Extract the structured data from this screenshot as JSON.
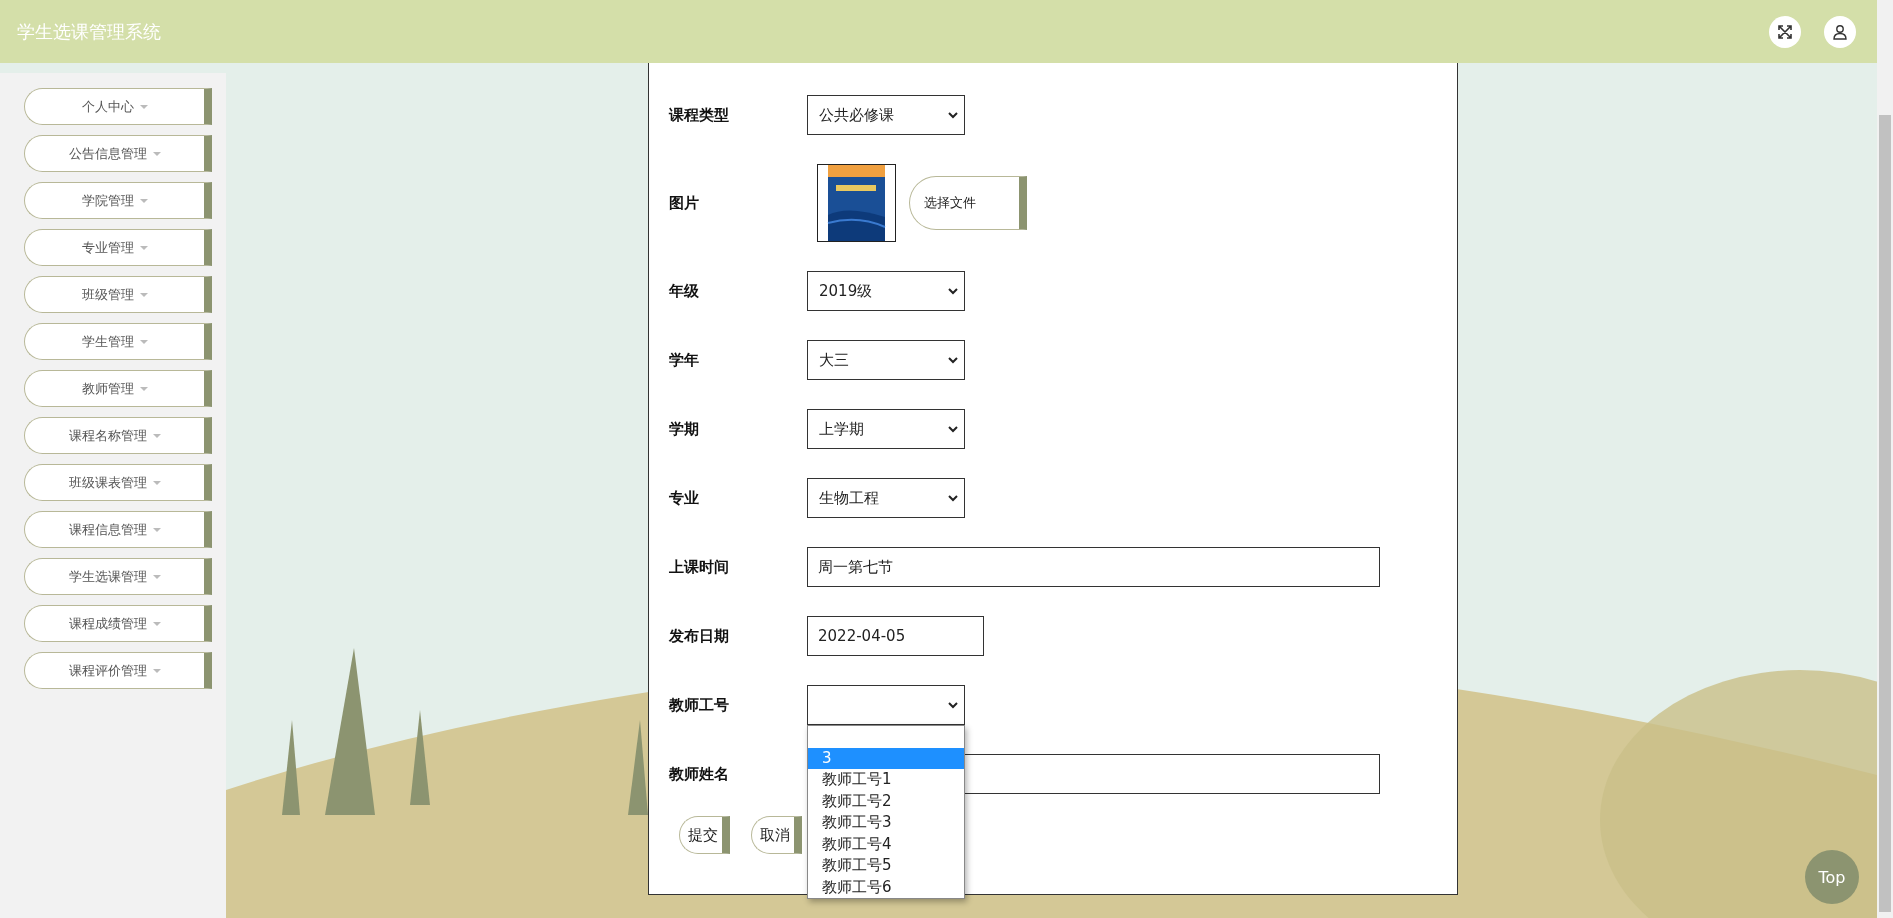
{
  "header": {
    "title": "学生选课管理系统"
  },
  "sidebar": {
    "items": [
      {
        "label": "个人中心"
      },
      {
        "label": "公告信息管理"
      },
      {
        "label": "学院管理"
      },
      {
        "label": "专业管理"
      },
      {
        "label": "班级管理"
      },
      {
        "label": "学生管理"
      },
      {
        "label": "教师管理"
      },
      {
        "label": "课程名称管理"
      },
      {
        "label": "班级课表管理"
      },
      {
        "label": "课程信息管理"
      },
      {
        "label": "学生选课管理"
      },
      {
        "label": "课程成绩管理"
      },
      {
        "label": "课程评价管理"
      }
    ]
  },
  "form": {
    "fields": [
      {
        "kind": "select",
        "label": "课程类型",
        "value": "公共必修课"
      },
      {
        "label": "图片",
        "button": "选择文件"
      },
      {
        "kind": "select",
        "label": "年级",
        "value": "2019级"
      },
      {
        "kind": "select",
        "label": "学年",
        "value": "大三"
      },
      {
        "kind": "select",
        "label": "学期",
        "value": "上学期"
      },
      {
        "kind": "select",
        "label": "专业",
        "value": "生物工程"
      },
      {
        "kind": "text",
        "label": "上课时间",
        "value": "周一第七节"
      },
      {
        "kind": "date",
        "label": "发布日期",
        "value": "2022-04-05"
      },
      {
        "kind": "select",
        "label": "教师工号",
        "expanded": true,
        "options": [
          {
            "selected": false
          },
          {
            "label": "3",
            "selected": true
          },
          {
            "label": "教师工号1",
            "selected": false
          },
          {
            "label": "教师工号2",
            "selected": false
          },
          {
            "label": "教师工号3",
            "selected": false
          },
          {
            "label": "教师工号4",
            "selected": false
          },
          {
            "label": "教师工号5",
            "selected": false
          },
          {
            "label": "教师工号6",
            "selected": false
          }
        ]
      },
      {
        "kind": "text",
        "label": "教师姓名"
      }
    ],
    "buttons": [
      {
        "label": "提交"
      },
      {
        "label": "取消"
      }
    ]
  },
  "top_button": {
    "label": "Top"
  }
}
